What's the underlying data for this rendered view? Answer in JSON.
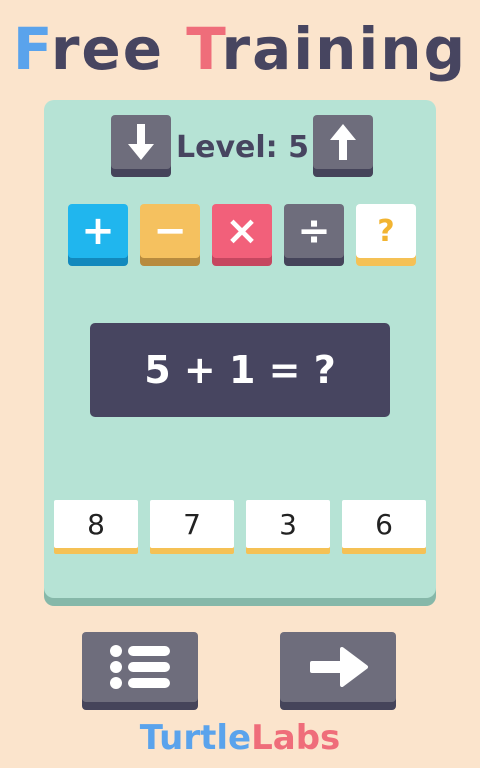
{
  "title": {
    "part1_first": "F",
    "part1_rest": "ree ",
    "part2_first": "T",
    "part2_rest": "raining"
  },
  "level": {
    "label": "Level: 5"
  },
  "operations": {
    "plus": "+",
    "minus": "−",
    "times": "×",
    "divide": "÷",
    "random": "?"
  },
  "equation": {
    "text": "5 + 1 = ?"
  },
  "answers": [
    "8",
    "7",
    "3",
    "6"
  ],
  "brand": {
    "part1": "Turtle",
    "part2": "Labs"
  },
  "colors": {
    "background": "#fbe4cc",
    "board": "#b6e3d5",
    "dark": "#474560",
    "blue": "#20b6ee",
    "yellow": "#f5c15f",
    "red": "#f2607a",
    "gray": "#6e6d7c"
  },
  "icons": {
    "level_down": "arrow-down-icon",
    "level_up": "arrow-up-icon",
    "menu": "list-icon",
    "next": "arrow-right-icon"
  }
}
